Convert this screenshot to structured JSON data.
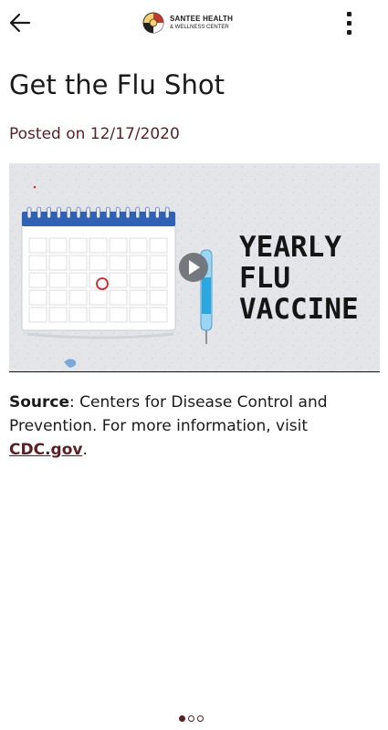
{
  "header": {
    "brand_line1": "SANTEE HEALTH",
    "brand_line2": "& WELLNESS CENTER",
    "back_icon": "arrow-left-icon",
    "menu_icon": "more-vertical-icon"
  },
  "article": {
    "title": "Get the Flu Shot",
    "posted": "Posted on 12/17/2020",
    "video": {
      "text_lines": [
        "YEARLY",
        "FLU",
        "VACCINE"
      ],
      "play_icon": "play-icon"
    },
    "source_label": "Source",
    "source_text": ": Centers for Disease Control and Prevention. For more information, visit ",
    "link_text": "CDC.gov",
    "after_link": "."
  },
  "pagination": {
    "total": 3,
    "active": 1
  },
  "colors": {
    "accent": "#5a1f22",
    "text": "#1a1a1a",
    "calendar_blue": "#2f62b4",
    "background": "#ffffff"
  }
}
